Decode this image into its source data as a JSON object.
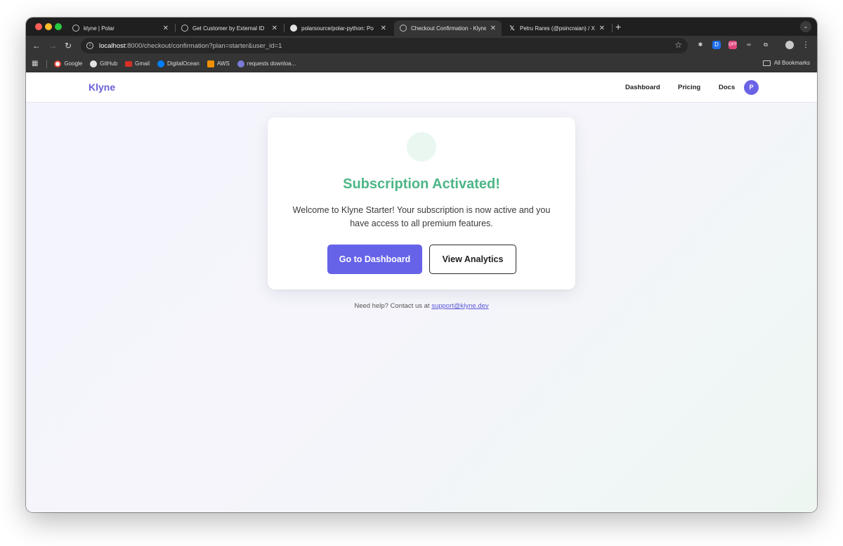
{
  "browser": {
    "tabs": [
      {
        "title": "klyne | Polar",
        "favicon": "globe-icon"
      },
      {
        "title": "Get Customer by External ID",
        "favicon": "globe-icon"
      },
      {
        "title": "polarsource/polar-python: Po",
        "favicon": "github-icon"
      },
      {
        "title": "Checkout Confirmation - Klyne",
        "favicon": "globe-icon"
      },
      {
        "title": "Petru Rares (@psincraian) / X",
        "favicon": "x-icon"
      }
    ],
    "active_tab": 3,
    "url_host": "localhost",
    "url_rest": ":8000/checkout/confirmation?plan=starter&user_id=1",
    "bookmarks": [
      {
        "label": "Google",
        "icon": "google-icon",
        "color": "#ea4335"
      },
      {
        "label": "GitHub",
        "icon": "github-icon",
        "color": "#e3e3e3"
      },
      {
        "label": "Gmail",
        "icon": "gmail-icon",
        "color": "#d93025"
      },
      {
        "label": "DigitalOcean",
        "icon": "digitalocean-icon",
        "color": "#0080ff"
      },
      {
        "label": "AWS",
        "icon": "aws-icon",
        "color": "#f29100"
      },
      {
        "label": "requests downloa...",
        "icon": "requests-icon",
        "color": "#7b7bd8"
      }
    ],
    "all_bookmarks_label": "All Bookmarks"
  },
  "site": {
    "logo": "Klyne",
    "nav": {
      "dashboard": "Dashboard",
      "pricing": "Pricing",
      "docs": "Docs"
    },
    "avatar_initial": "P"
  },
  "confirmation": {
    "title": "Subscription Activated!",
    "message": "Welcome to Klyne Starter! Your subscription is now active and you have access to all premium features.",
    "primary_button": "Go to Dashboard",
    "secondary_button": "View Analytics"
  },
  "help": {
    "text": "Need help? Contact us at ",
    "email": "support@klyne.dev"
  },
  "colors": {
    "brand": "#6b5fd8",
    "success": "#4cb686",
    "primary_button": "#6663e9"
  }
}
